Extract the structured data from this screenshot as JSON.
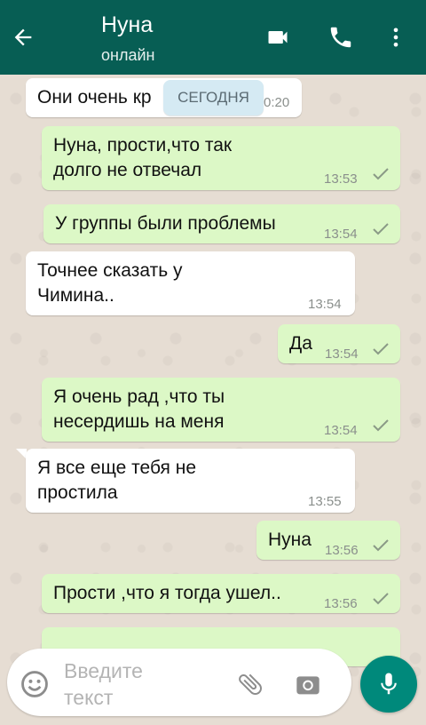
{
  "header": {
    "contact_name": "Нуна",
    "status": "онлайн",
    "icons": [
      "back-arrow-icon",
      "video-call-icon",
      "phone-icon",
      "more-vert-icon"
    ],
    "color": "#075e54"
  },
  "date_chip": "СЕГОДНЯ",
  "messages": [
    {
      "dir": "in",
      "text": "Они очень кр",
      "time": "0:20"
    },
    {
      "dir": "out",
      "text": "Нуна, прости,что так\nдолго не отвечал",
      "time": "13:53",
      "ticks": "sent"
    },
    {
      "dir": "out",
      "text": "У группы были проблемы",
      "time": "13:54",
      "ticks": "sent"
    },
    {
      "dir": "in",
      "text": "Точнее сказать у\nЧимина..",
      "time": "13:54"
    },
    {
      "dir": "out",
      "text": "Да",
      "time": "13:54",
      "ticks": "sent"
    },
    {
      "dir": "out",
      "text": "Я очень рад ,что ты\nнесердишь на меня",
      "time": "13:54",
      "ticks": "sent"
    },
    {
      "dir": "in",
      "text": "Я все еще тебя не\nпростила",
      "time": "13:55"
    },
    {
      "dir": "out",
      "text": "Нуна",
      "time": "13:56",
      "ticks": "sent"
    },
    {
      "dir": "out",
      "text": "Прости ,что я тогда ушел..",
      "time": "13:56",
      "ticks": "sent"
    }
  ],
  "composer": {
    "placeholder": "Введите\nтекст",
    "icons": [
      "emoji-icon",
      "attach-icon",
      "camera-icon",
      "mic-icon"
    ]
  },
  "colors": {
    "incoming": "#ffffff",
    "outgoing": "#dcf8c6",
    "accent": "#00897b",
    "chat_bg": "#e6ddd3"
  }
}
